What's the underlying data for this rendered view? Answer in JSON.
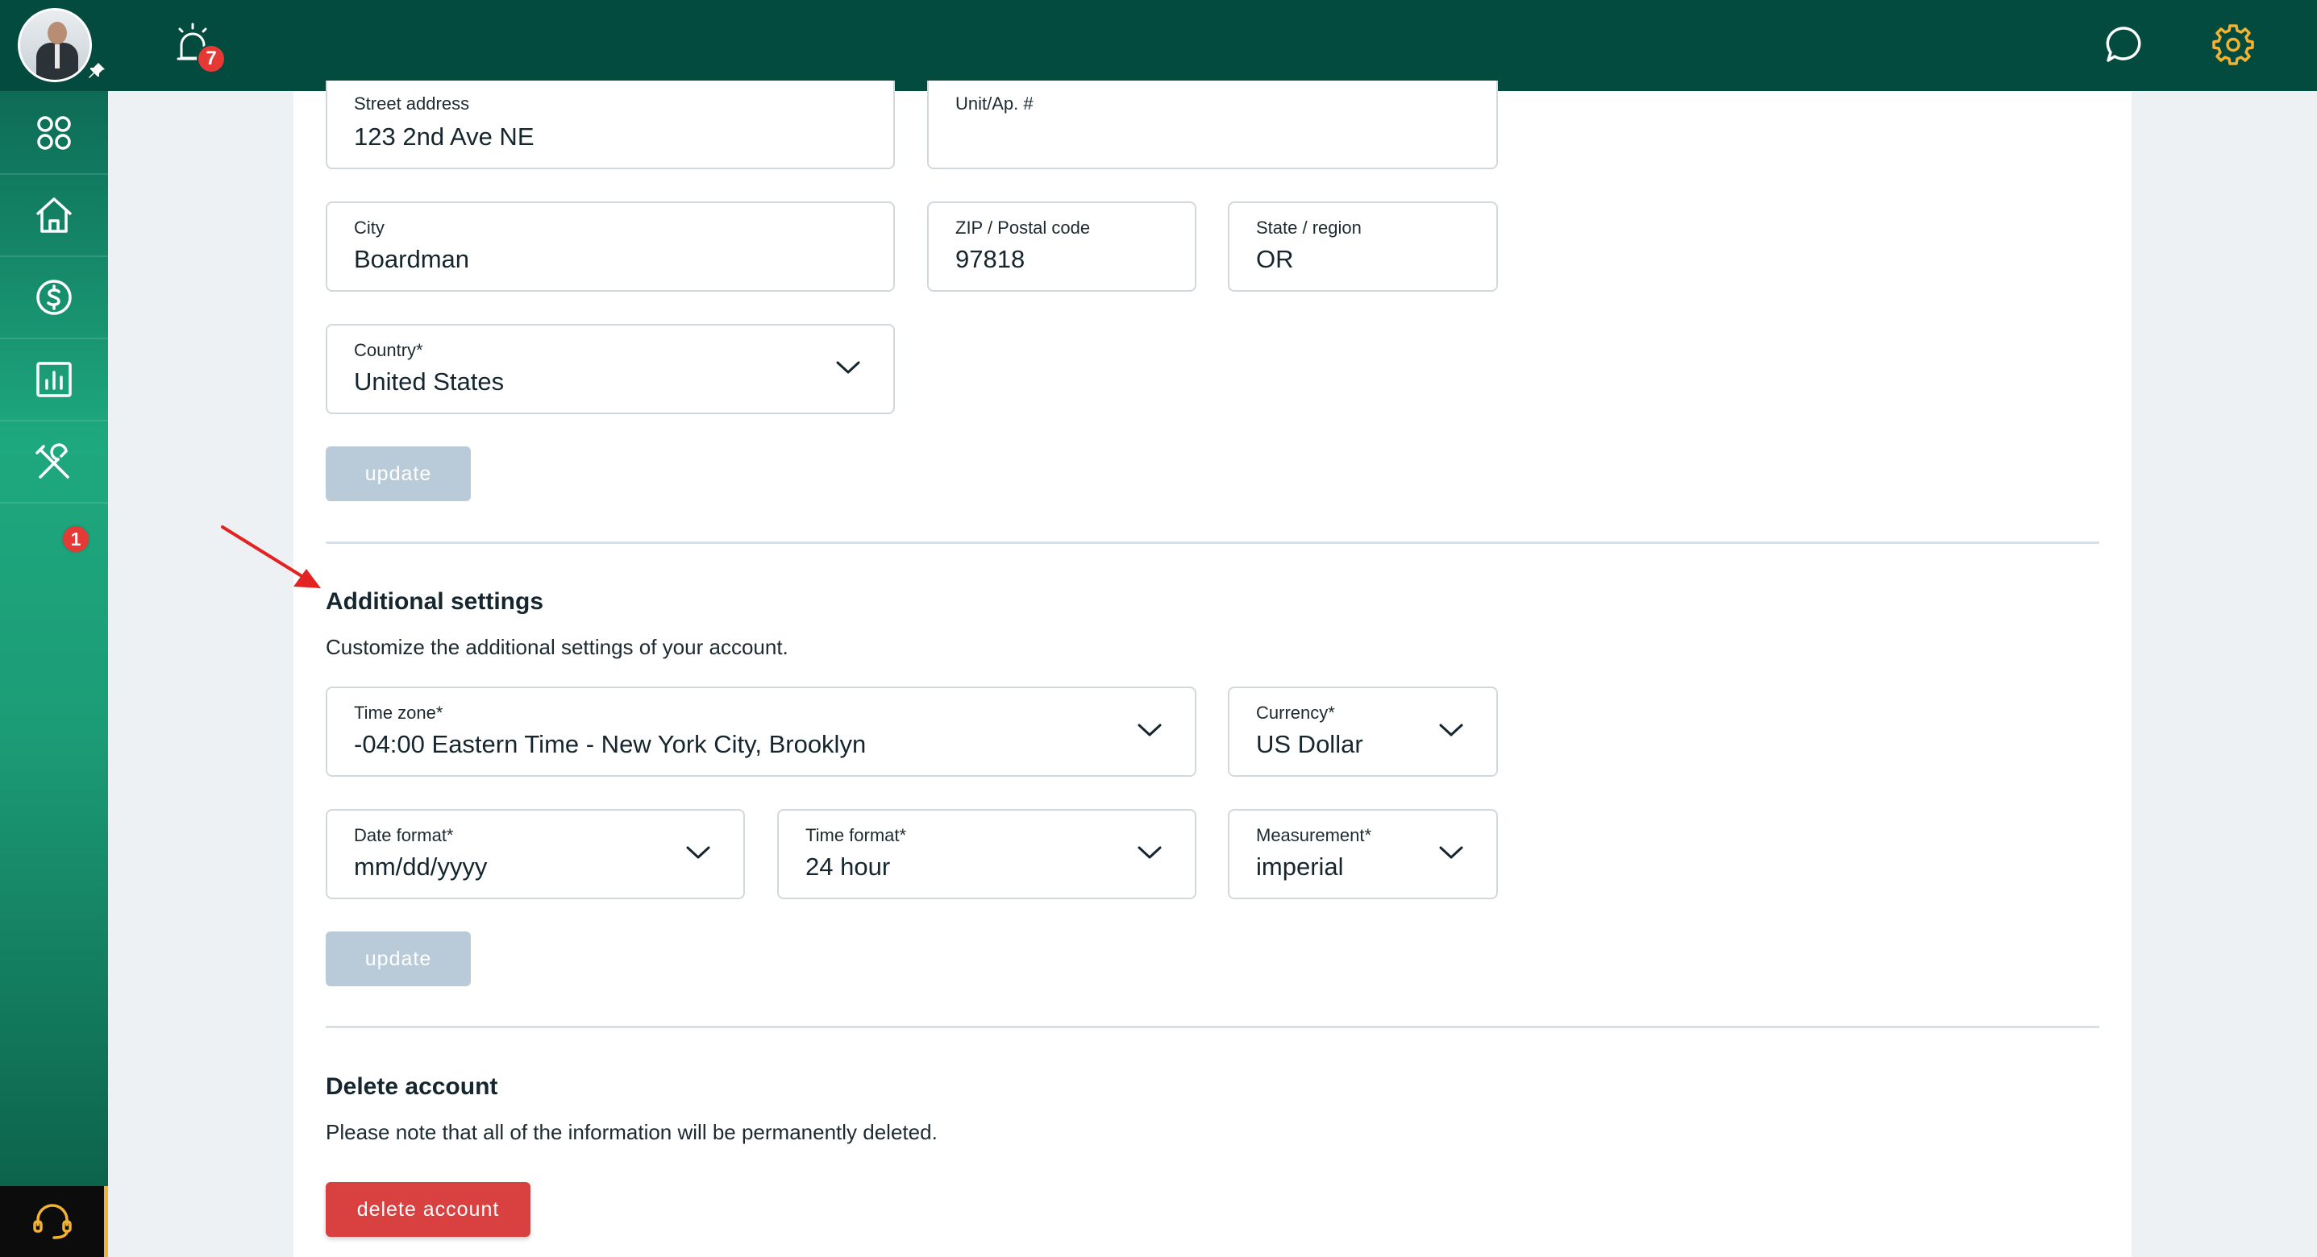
{
  "header": {
    "alarm_badge": "7"
  },
  "sidebar": {
    "tools_badge": "1",
    "items": [
      "dashboard-icon",
      "home-icon",
      "dollar-icon",
      "chart-icon",
      "tools-icon"
    ]
  },
  "address": {
    "street": {
      "label": "Street address",
      "value": "123 2nd Ave NE"
    },
    "unit": {
      "label": "Unit/Ap. #",
      "value": ""
    },
    "city": {
      "label": "City",
      "value": "Boardman"
    },
    "zip": {
      "label": "ZIP / Postal code",
      "value": "97818"
    },
    "state": {
      "label": "State / region",
      "value": "OR"
    },
    "country": {
      "label": "Country*",
      "value": "United States"
    },
    "update_label": "update"
  },
  "additional": {
    "title": "Additional settings",
    "description": "Customize the additional settings of your account.",
    "timezone": {
      "label": "Time zone*",
      "value": "-04:00 Eastern Time - New York City, Brooklyn"
    },
    "currency": {
      "label": "Currency*",
      "value": "US Dollar"
    },
    "date_format": {
      "label": "Date format*",
      "value": "mm/dd/yyyy"
    },
    "time_format": {
      "label": "Time format*",
      "value": "24 hour"
    },
    "measurement": {
      "label": "Measurement*",
      "value": "imperial"
    },
    "update_label": "update"
  },
  "delete": {
    "title": "Delete account",
    "description": "Please note that all of the information will be permanently deleted.",
    "button_label": "delete account"
  },
  "colors": {
    "topbar": "#024b3e",
    "accent_gear": "#f2b233",
    "delete": "#d94141",
    "badge": "#e53935",
    "annotation_arrow": "#e32222"
  }
}
